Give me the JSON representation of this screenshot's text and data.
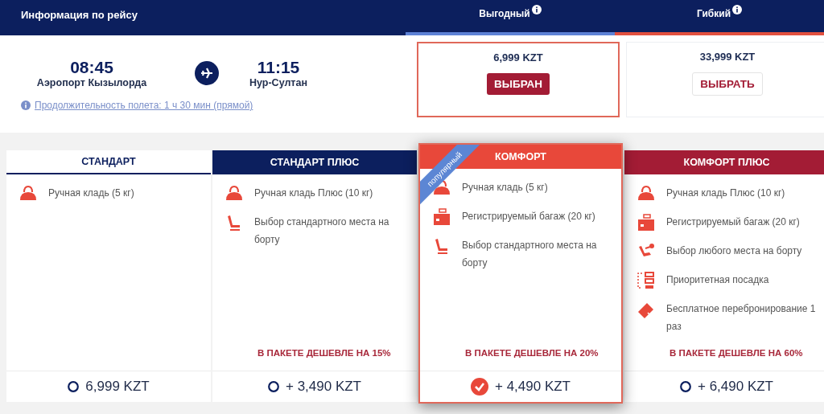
{
  "header": {
    "title": "Информация по рейсу"
  },
  "fares": [
    {
      "name": "Выгодный",
      "kind": "economy",
      "price": "6,999 KZT",
      "button": "ВЫБРАН",
      "selected": true
    },
    {
      "name": "Гибкий",
      "kind": "flex",
      "price": "33,999 KZT",
      "button": "ВЫБРАТЬ",
      "selected": false
    }
  ],
  "flight": {
    "departure_time": "08:45",
    "departure_place": "Аэропорт Кызылорда",
    "arrival_time": "11:15",
    "arrival_place": "Нур-Султан",
    "duration": "Продолжительность полета: 1 ч 30 мин (прямой)"
  },
  "packages": [
    {
      "name": "СТАНДАРТ",
      "kind": "standard",
      "selected": false,
      "features": [
        {
          "kind": "bag",
          "text": "Ручная кладь (5 кг)"
        }
      ],
      "price": "6,999 KZT"
    },
    {
      "name": "СТАНДАРТ ПЛЮС",
      "kind": "plus",
      "selected": false,
      "features": [
        {
          "kind": "bag",
          "text": "Ручная кладь Плюс (10 кг)"
        },
        {
          "kind": "seat",
          "text": "Выбор стандартного места на борту"
        }
      ],
      "discount": "В ПАКЕТЕ ДЕШЕВЛЕ НА 15%",
      "price": "+ 3,490 KZT"
    },
    {
      "name": "КОМФОРТ",
      "kind": "comfort",
      "selected": true,
      "ribbon": "популярный",
      "features": [
        {
          "kind": "bag",
          "text": "Ручная кладь (5 кг)"
        },
        {
          "kind": "luggage",
          "text": "Регистрируемый багаж (20 кг)"
        },
        {
          "kind": "seat",
          "text": "Выбор стандартного места на борту"
        }
      ],
      "discount": "В ПАКЕТЕ ДЕШЕВЛЕ НА 20%",
      "price": "+ 4,490 KZT"
    },
    {
      "name": "КОМФОРТ ПЛЮС",
      "kind": "comfort_plus",
      "selected": false,
      "features": [
        {
          "kind": "bag",
          "text": "Ручная кладь Плюс (10 кг)"
        },
        {
          "kind": "luggage",
          "text": "Регистрируемый багаж (20 кг)"
        },
        {
          "kind": "seat_any",
          "text": "Выбор любого места на борту"
        },
        {
          "kind": "priority",
          "text": "Приоритетная посадка"
        },
        {
          "kind": "rebook",
          "text": "Бесплатное перебронирование 1 раз"
        }
      ],
      "discount": "В ПАКЕТЕ ДЕШЕВЛЕ НА 60%",
      "price": "+ 6,490 KZT"
    }
  ]
}
